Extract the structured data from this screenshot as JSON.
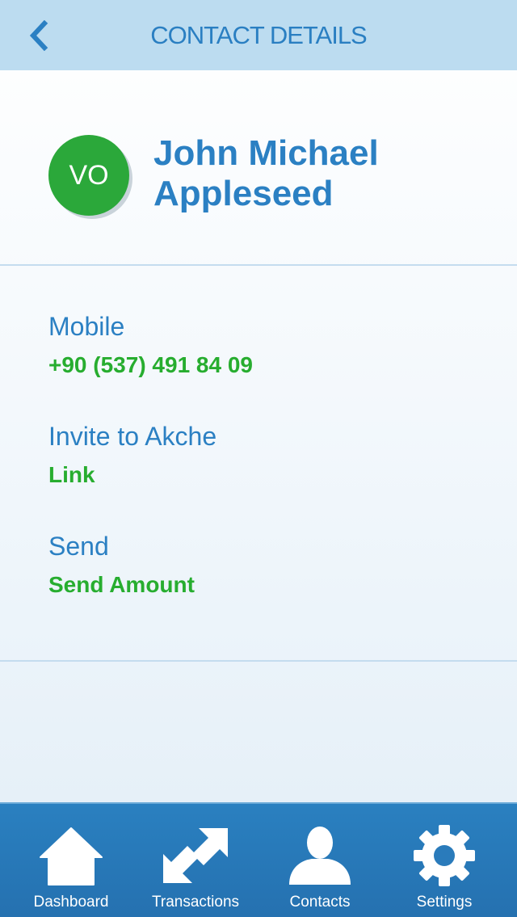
{
  "header": {
    "title": "CONTACT DETAILS"
  },
  "profile": {
    "initials": "VO",
    "name_line1": "John Michael",
    "name_line2": "Appleseed",
    "avatar_color": "#2ba83a"
  },
  "details": {
    "mobile_label": "Mobile",
    "mobile_value": "+90 (537) 491 84 09",
    "invite_label": "Invite to Akche",
    "invite_value": "Link",
    "send_label": "Send",
    "send_value": "Send Amount"
  },
  "tabbar": {
    "items": [
      {
        "label": "Dashboard",
        "icon": "home-icon"
      },
      {
        "label": "Transactions",
        "icon": "arrows-icon"
      },
      {
        "label": "Contacts",
        "icon": "person-icon"
      },
      {
        "label": "Settings",
        "icon": "gear-icon"
      }
    ]
  },
  "colors": {
    "header_bg": "#bcdcf0",
    "primary_blue": "#2b80c3",
    "accent_green": "#27ad2f",
    "tabbar_bg": "#2a80c0"
  }
}
